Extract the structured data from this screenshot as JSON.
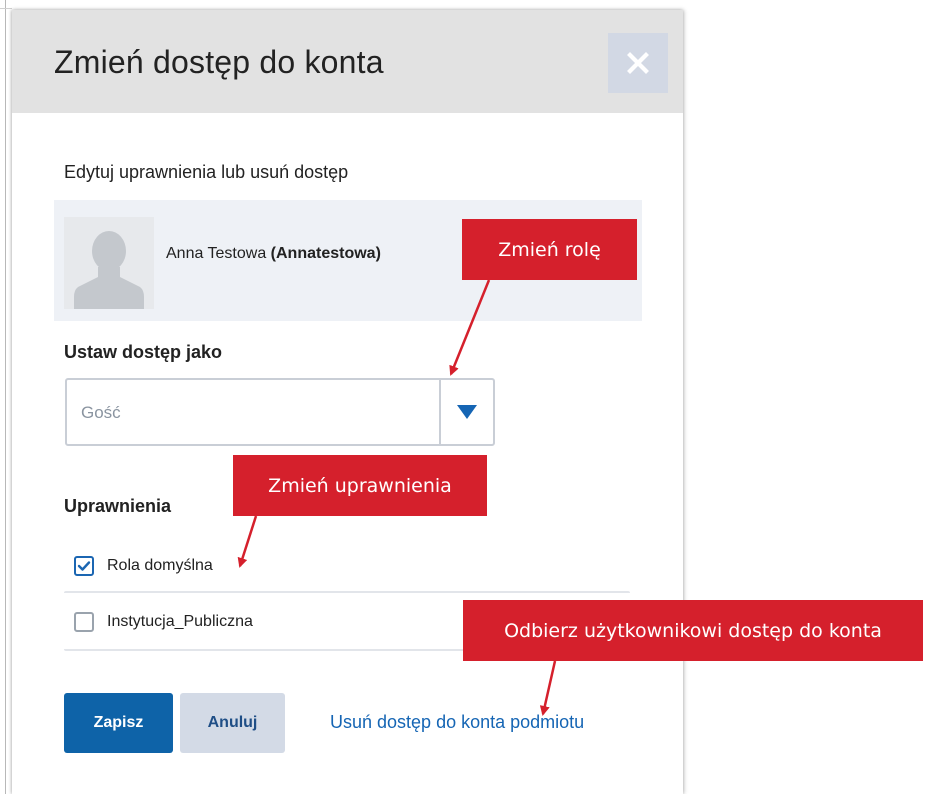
{
  "dialog": {
    "title": "Zmień dostęp do konta",
    "subtitle": "Edytuj uprawnienia lub usuń dostęp"
  },
  "user": {
    "name": "Anna Testowa",
    "login": "(Annatestowa)"
  },
  "access": {
    "label": "Ustaw dostęp jako",
    "selected": "Gość"
  },
  "permissions": {
    "label": "Uprawnienia",
    "items": [
      {
        "label": "Rola domyślna",
        "checked": true
      },
      {
        "label": "Instytucja_Publiczna",
        "checked": false
      }
    ]
  },
  "buttons": {
    "save": "Zapisz",
    "cancel": "Anuluj",
    "remove_link": "Usuń dostęp do konta podmiotu"
  },
  "callouts": {
    "change_role": "Zmień rolę",
    "change_permissions": "Zmień uprawnienia",
    "revoke_access": "Odbierz użytkownikowi dostęp do konta"
  },
  "colors": {
    "primary": "#0e63a8",
    "link": "#1565b4",
    "callout": "#d5202c"
  }
}
